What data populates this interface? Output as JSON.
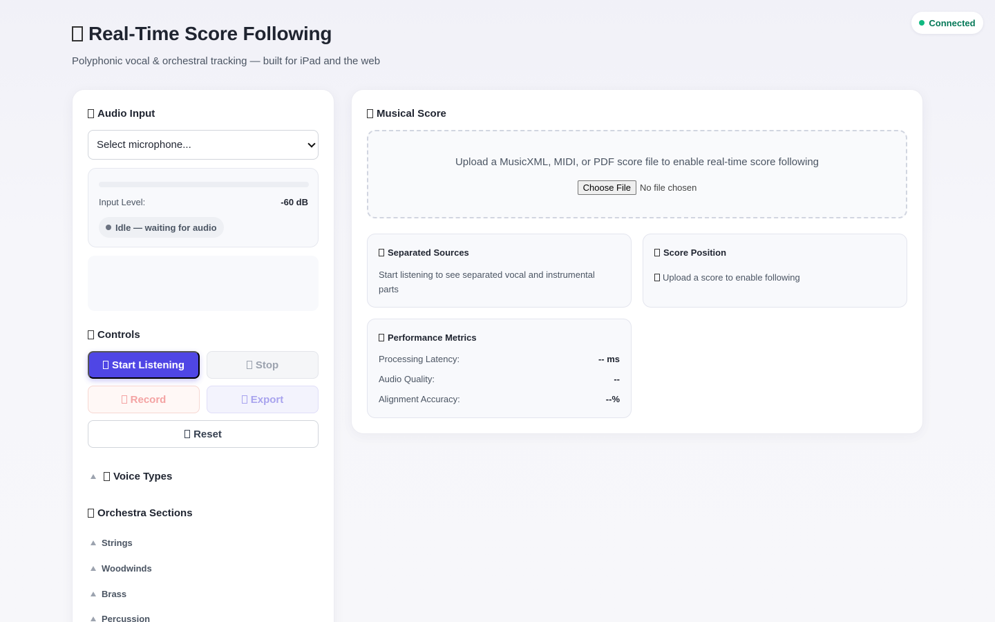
{
  "status": {
    "label": "Connected",
    "color": "#10b981"
  },
  "header": {
    "title": "Real-Time Score Following",
    "subtitle": "Polyphonic vocal & orchestral tracking — built for iPad and the web"
  },
  "audio_input": {
    "heading": "Audio Input",
    "select_value": "Select microphone...",
    "level_label": "Input Level:",
    "level_value": "-60 dB",
    "level_fraction": 0,
    "state_label": "Idle — waiting for audio"
  },
  "controls": {
    "heading": "Controls",
    "start": "Start Listening",
    "stop": "Stop",
    "record": "Record",
    "export": "Export",
    "reset": "Reset",
    "accent": "#4f46e5"
  },
  "voice_types": {
    "heading": "Voice Types"
  },
  "orchestra": {
    "heading": "Orchestra Sections",
    "sections": [
      "Strings",
      "Woodwinds",
      "Brass",
      "Percussion"
    ]
  },
  "score": {
    "heading": "Musical Score",
    "upload_prompt": "Upload a MusicXML, MIDI, or PDF score file to enable real-time score following",
    "file_button": "Choose File",
    "file_status": "No file chosen"
  },
  "separated_sources": {
    "title": "Separated Sources",
    "body": "Start listening to see separated vocal and instrumental parts"
  },
  "score_position": {
    "title": "Score Position",
    "body": "Upload a score to enable following"
  },
  "metrics": {
    "title": "Performance Metrics",
    "rows": [
      {
        "label": "Processing Latency:",
        "value": "-- ms"
      },
      {
        "label": "Audio Quality:",
        "value": "--"
      },
      {
        "label": "Alignment Accuracy:",
        "value": "--%"
      }
    ]
  }
}
